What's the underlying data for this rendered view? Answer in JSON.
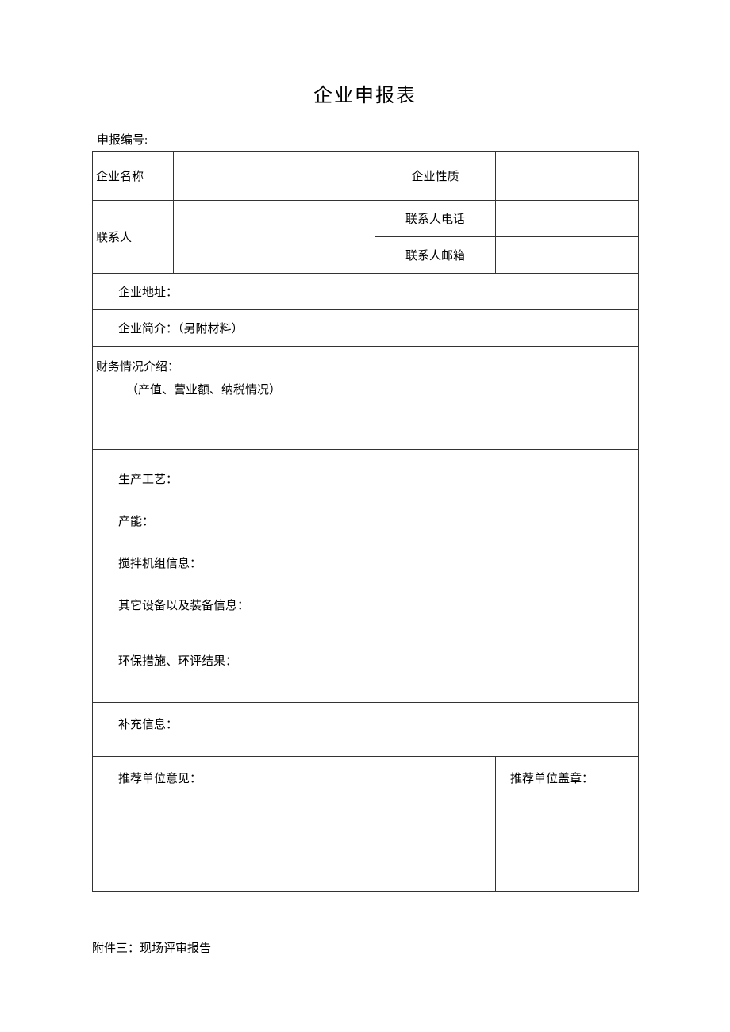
{
  "title": "企业申报表",
  "reg_number_label": "申报编号:",
  "labels": {
    "company_name": "企业名称",
    "company_type": "企业性质",
    "contact_person": "联系人",
    "contact_phone": "联系人电话",
    "contact_email": "联系人邮箱",
    "address": "企业地址：",
    "intro": "企业简介：（另附材料）",
    "finance_header": "财务情况介绍：",
    "finance_sub": "（产值、营业额、纳税情况）",
    "production_process": "生产工艺：",
    "capacity": "产能：",
    "mixer_info": "搅拌机组信息：",
    "other_equipment": "其它设备以及装备信息：",
    "env": "环保措施、环评结果：",
    "supplement": "补充信息：",
    "recommend_opinion": "推荐单位意见：",
    "recommend_seal": "推荐单位盖章："
  },
  "appendix": "附件三：现场评审报告"
}
